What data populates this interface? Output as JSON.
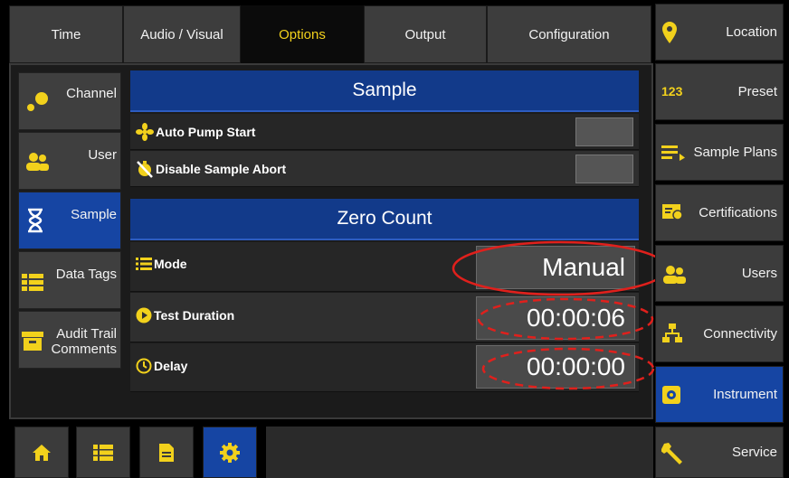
{
  "top_tabs": [
    {
      "label": "Time",
      "active": false
    },
    {
      "label": "Audio / Visual",
      "active": false
    },
    {
      "label": "Options",
      "active": true
    },
    {
      "label": "Output",
      "active": false
    },
    {
      "label": "Configuration",
      "active": false
    }
  ],
  "left_nav": [
    {
      "label": "Channel",
      "icon": "dots-icon",
      "active": false
    },
    {
      "label": "User",
      "icon": "users-icon",
      "active": false
    },
    {
      "label": "Sample",
      "icon": "hourglass-icon",
      "active": true
    },
    {
      "label": "Data Tags",
      "icon": "list-icon",
      "active": false
    },
    {
      "label": "Audit Trail Comments",
      "icon": "archive-icon",
      "active": false
    }
  ],
  "sample_section": {
    "title": "Sample",
    "rows": [
      {
        "label": "Auto Pump Start",
        "icon": "fan-icon"
      },
      {
        "label": "Disable Sample Abort",
        "icon": "stopwatch-off-icon"
      }
    ]
  },
  "zero_count_section": {
    "title": "Zero Count",
    "mode": {
      "label": "Mode",
      "value": "Manual",
      "icon": "list-icon"
    },
    "test_duration": {
      "label": "Test Duration",
      "value": "00:00:06",
      "icon": "play-circle-icon"
    },
    "delay": {
      "label": "Delay",
      "value": "00:00:00",
      "icon": "timer-icon"
    }
  },
  "right_nav": [
    {
      "label": "Location",
      "icon": "map-pin-icon",
      "active": false
    },
    {
      "label": "Preset",
      "icon": "numeric-icon",
      "icon_text": "123",
      "active": false
    },
    {
      "label": "Sample Plans",
      "icon": "plan-list-icon",
      "active": false
    },
    {
      "label": "Certifications",
      "icon": "certificate-icon",
      "active": false
    },
    {
      "label": "Users",
      "icon": "users-icon",
      "active": false
    },
    {
      "label": "Connectivity",
      "icon": "network-icon",
      "active": false
    },
    {
      "label": "Instrument",
      "icon": "gear-box-icon",
      "active": true
    },
    {
      "label": "Service",
      "icon": "wrench-icon",
      "active": false
    }
  ],
  "bottom_bar": [
    {
      "icon": "home-icon",
      "active": false
    },
    {
      "icon": "list-icon",
      "active": false
    },
    {
      "icon": "document-icon",
      "active": false
    },
    {
      "icon": "gear-icon",
      "active": true
    }
  ],
  "colors": {
    "accent_blue": "#1645a3",
    "section_header": "#123a8a",
    "active_tab_text": "#f2d11c",
    "icon_yellow": "#f2d11c",
    "annotation_red": "#e0201c"
  }
}
